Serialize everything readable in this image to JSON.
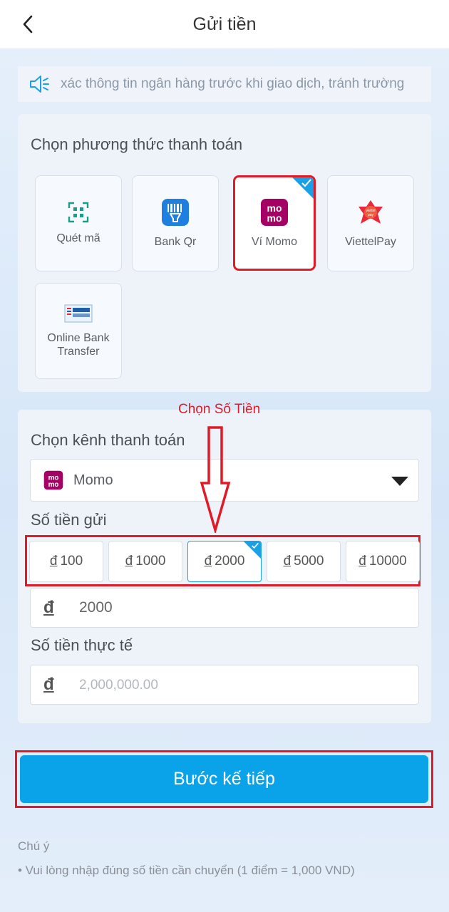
{
  "header": {
    "title": "Gửi tiền"
  },
  "notice": {
    "text": "xác thông tin ngân hàng trước khi giao dịch, tránh trường"
  },
  "methods": {
    "title": "Chọn phương thức thanh toán",
    "items": [
      {
        "label": "Quét mã",
        "icon": "qr-scan-icon"
      },
      {
        "label": "Bank Qr",
        "icon": "bank-qr-icon"
      },
      {
        "label": "Ví Momo",
        "icon": "momo-logo-icon",
        "selected": true
      },
      {
        "label": "ViettelPay",
        "icon": "viettelpay-logo-icon"
      },
      {
        "label": "Online Bank Transfer",
        "icon": "bank-transfer-logo-icon"
      }
    ]
  },
  "annotation": {
    "text": "Chọn Số Tiền"
  },
  "channel": {
    "title": "Chọn kênh thanh toán",
    "selected": "Momo"
  },
  "amount": {
    "title": "Số tiền gửi",
    "currency_symbol": "đ",
    "options": [
      "100",
      "1000",
      "2000",
      "5000",
      "10000"
    ],
    "selected": "2000",
    "input_value": "2000"
  },
  "actual": {
    "title": "Số tiền thực tế",
    "placeholder": "2,000,000.00"
  },
  "next_button": {
    "label": "Bước kế tiếp"
  },
  "note": {
    "title": "Chú ý",
    "text": "• Vui lòng nhập đúng số tiền cần chuyển (1 điểm = 1,000 VND)"
  },
  "colors": {
    "accent": "#0aa3ea",
    "highlight": "#e01a27",
    "momo": "#a50064"
  }
}
